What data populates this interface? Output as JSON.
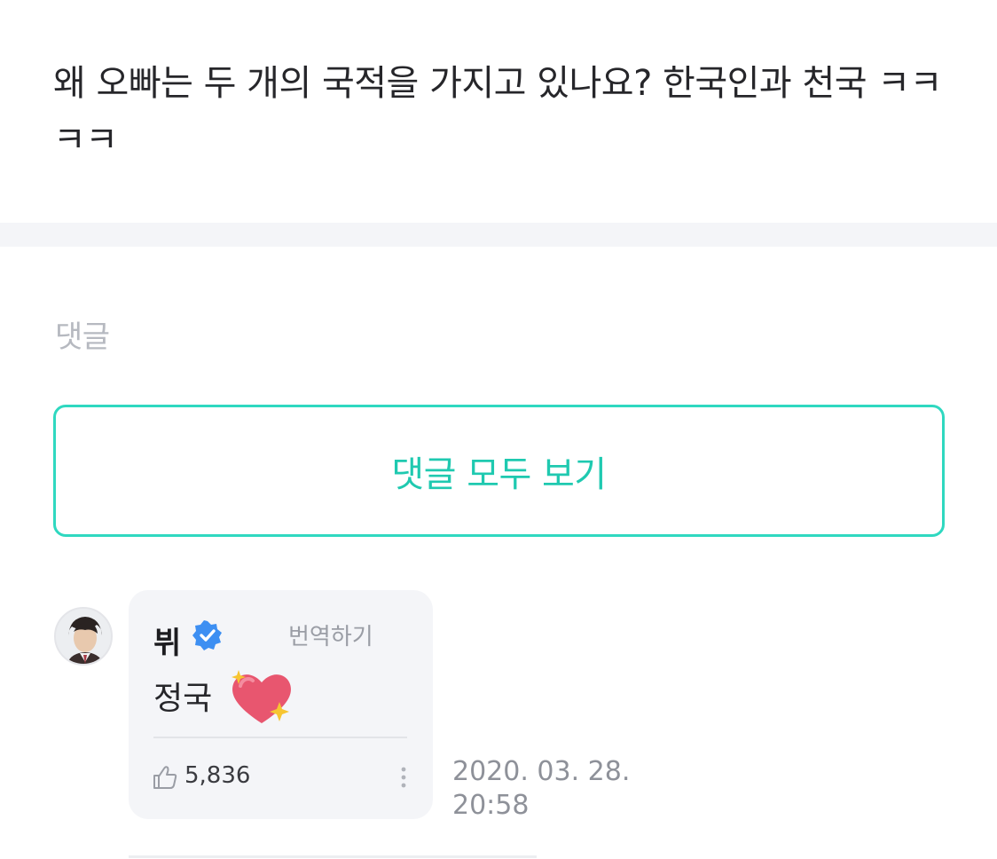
{
  "post": {
    "text": "왜 오빠는 두 개의 국적을 가지고 있나요? 한국인과 천국 ㅋㅋㅋㅋ"
  },
  "comments": {
    "heading": "댓글",
    "view_all_label": "댓글 모두 보기",
    "items": [
      {
        "author": "뷔",
        "verified": true,
        "translate_label": "번역하기",
        "body": "정국",
        "emoji": "sparkling-heart",
        "likes": "5,836",
        "date": "2020. 03. 28.",
        "time": "20:58"
      }
    ]
  },
  "colors": {
    "accent": "#2fd8c0",
    "accent_text": "#1fc9b0",
    "verified_badge": "#3d8ff2",
    "card_bg": "#f4f5f8",
    "heart": "#e8566f",
    "sparkle": "#f7c531"
  }
}
